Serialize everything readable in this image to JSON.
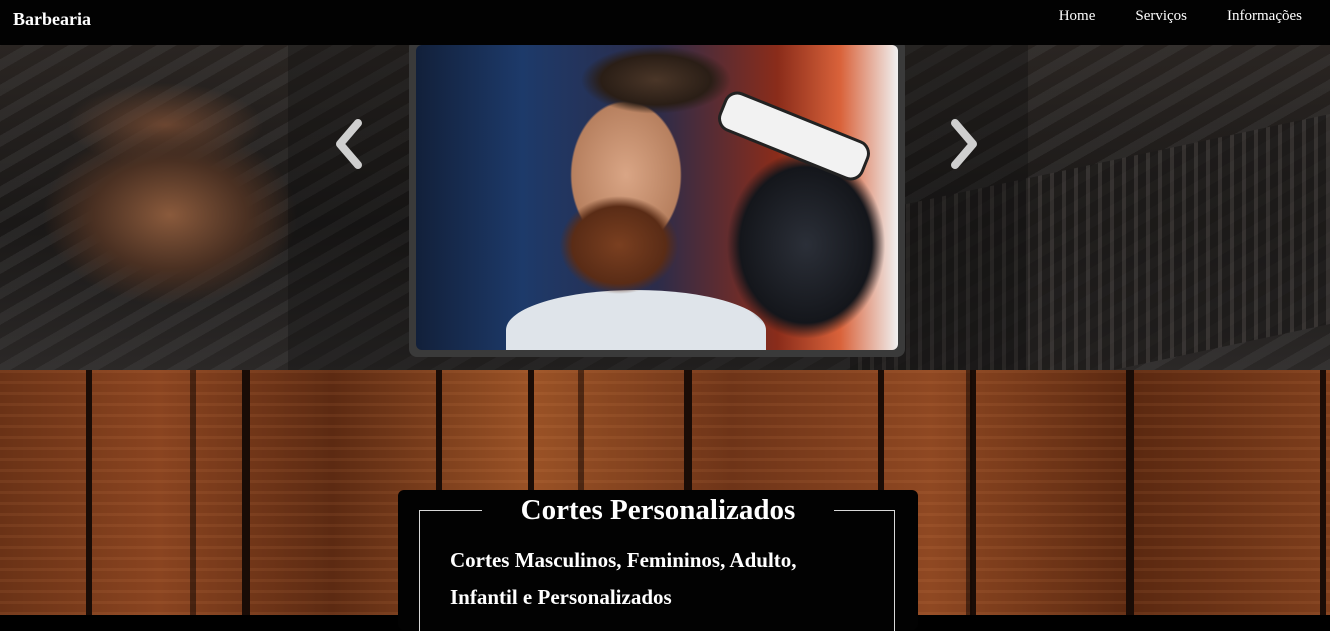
{
  "navbar": {
    "brand": "Barbearia",
    "links": [
      "Home",
      "Serviços",
      "Informações"
    ]
  },
  "carousel": {
    "prev_icon": "chevron-left-icon",
    "next_icon": "chevron-right-icon",
    "slide_image": "barber-trimming-beard-photo"
  },
  "card": {
    "title": "Cortes Personalizados",
    "line1": "Cortes Masculinos, Femininos, Adulto,",
    "line2": "Infantil e Personalizados"
  },
  "colors": {
    "navbar_bg": "#020202",
    "text": "#ffffff",
    "card_bg": "#020202",
    "wood": "#7e3e1c"
  }
}
